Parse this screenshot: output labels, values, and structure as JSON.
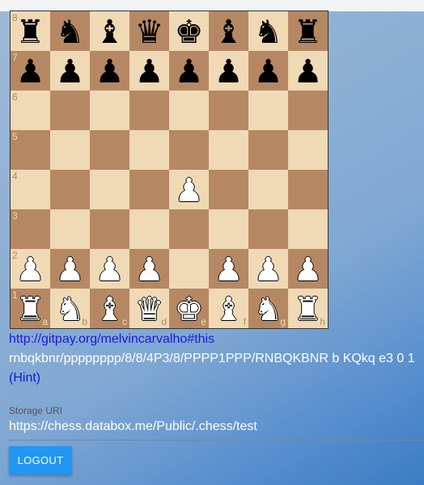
{
  "board": {
    "ranks": [
      "8",
      "7",
      "6",
      "5",
      "4",
      "3",
      "2",
      "1"
    ],
    "files": [
      "a",
      "b",
      "c",
      "d",
      "e",
      "f",
      "g",
      "h"
    ],
    "position": [
      [
        "r",
        "n",
        "b",
        "q",
        "k",
        "b",
        "n",
        "r"
      ],
      [
        "p",
        "p",
        "p",
        "p",
        "p",
        "p",
        "p",
        "p"
      ],
      [
        "",
        "",
        "",
        "",
        "",
        "",
        "",
        ""
      ],
      [
        "",
        "",
        "",
        "",
        "",
        "",
        "",
        ""
      ],
      [
        "",
        "",
        "",
        "",
        "P",
        "",
        "",
        ""
      ],
      [
        "",
        "",
        "",
        "",
        "",
        "",
        "",
        ""
      ],
      [
        "P",
        "P",
        "P",
        "P",
        "",
        "P",
        "P",
        "P"
      ],
      [
        "R",
        "N",
        "B",
        "Q",
        "K",
        "B",
        "N",
        "R"
      ]
    ],
    "colors": {
      "light": "#f0d9b5",
      "dark": "#b58863"
    }
  },
  "links": {
    "gitpay": "http://gitpay.org/melvincarvalho#this",
    "hint": "(Hint)"
  },
  "fen": "rnbqkbnr/pppppppp/8/8/4P3/8/PPPP1PPP/RNBQKBNR b KQkq e3 0 1",
  "storage": {
    "label": "Storage URI",
    "value": "https://chess.databox.me/Public/.chess/test"
  },
  "actions": {
    "logout": "LOGOUT"
  }
}
